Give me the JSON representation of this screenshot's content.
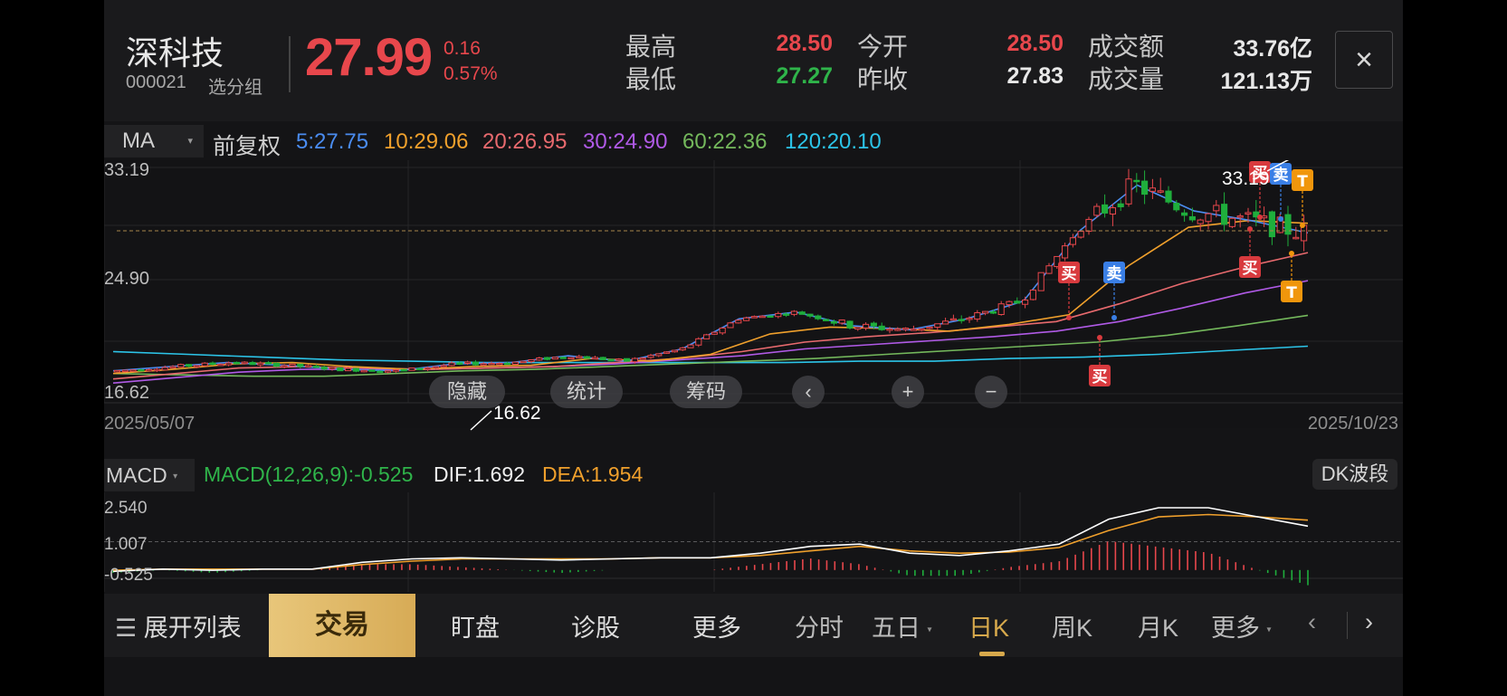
{
  "header": {
    "stock_name": "深科技",
    "stock_code": "000021",
    "group_selector": "选分组",
    "price": "27.99",
    "change": "0.16",
    "change_pct": "0.57%",
    "quotes": [
      {
        "label": "最高",
        "value": "28.50",
        "color": "red"
      },
      {
        "label": "最低",
        "value": "27.27",
        "color": "green"
      },
      {
        "label": "今开",
        "value": "28.50",
        "color": "red"
      },
      {
        "label": "昨收",
        "value": "27.83",
        "color": "white"
      },
      {
        "label": "成交额",
        "value": "33.76亿",
        "color": "white"
      },
      {
        "label": "成交量",
        "value": "121.13万",
        "color": "white"
      }
    ],
    "close_icon": "×"
  },
  "indicator_bar": {
    "selector": "MA",
    "adjust": "前复权",
    "ma_values": [
      {
        "text": "5:27.75",
        "color": "#4a8cf0"
      },
      {
        "text": "10:29.06",
        "color": "#f0a02c"
      },
      {
        "text": "20:26.95",
        "color": "#e86a6e"
      },
      {
        "text": "30:24.90",
        "color": "#b05ae6"
      },
      {
        "text": "60:22.36",
        "color": "#74b85c"
      },
      {
        "text": "120:20.10",
        "color": "#2cc4e8"
      }
    ]
  },
  "chart_data": {
    "type": "candlestick",
    "y_axis_labels": [
      "33.19",
      "24.90",
      "16.62"
    ],
    "ylim": [
      16.62,
      33.19
    ],
    "x_start": "2025/05/07",
    "x_end": "2025/10/23",
    "high_label": "33.19",
    "low_label": "16.62",
    "last_close": 27.99,
    "ma5": [
      18.3,
      18.6,
      18.9,
      18.7,
      18.4,
      18.3,
      18.8,
      18.9,
      19.4,
      19.0,
      19.9,
      22.1,
      22.6,
      21.6,
      21.3,
      22.1,
      23.4,
      28.6,
      31.9,
      30.0,
      29.3,
      28.4
    ],
    "ma10": [
      18.1,
      18.4,
      18.8,
      18.9,
      18.6,
      18.4,
      18.6,
      18.7,
      19.2,
      19.0,
      19.5,
      21.0,
      21.5,
      21.4,
      21.2,
      21.7,
      22.4,
      26.0,
      28.8,
      29.3,
      29.1
    ],
    "ma20": [
      17.7,
      18.1,
      18.5,
      18.6,
      18.5,
      18.4,
      18.5,
      18.6,
      18.9,
      19.2,
      19.7,
      20.4,
      20.8,
      21.1,
      21.5,
      21.9,
      23.2,
      24.7,
      25.9,
      26.95
    ],
    "ma30": [
      17.4,
      17.8,
      18.2,
      18.4,
      18.4,
      18.4,
      18.5,
      18.6,
      18.8,
      19.1,
      19.4,
      19.9,
      20.2,
      20.5,
      20.8,
      21.2,
      21.9,
      22.9,
      24.0,
      24.9
    ],
    "ma60": [
      18.1,
      18.0,
      17.9,
      17.9,
      18.1,
      18.3,
      18.4,
      18.6,
      18.8,
      19.0,
      19.2,
      19.5,
      19.8,
      20.1,
      20.4,
      20.9,
      21.6,
      22.36
    ],
    "ma120": [
      19.7,
      19.5,
      19.3,
      19.1,
      19.0,
      18.9,
      18.9,
      18.9,
      18.9,
      18.9,
      19.0,
      19.0,
      19.2,
      19.3,
      19.5,
      19.8,
      20.1
    ],
    "signals": [
      {
        "type": "买",
        "kind": "buy"
      },
      {
        "type": "卖",
        "kind": "sell"
      },
      {
        "type": "买",
        "kind": "buy"
      },
      {
        "type": "买",
        "kind": "buy"
      },
      {
        "type": "卖",
        "kind": "sell"
      },
      {
        "type": "买",
        "kind": "buy"
      },
      {
        "type": "T",
        "kind": "t"
      },
      {
        "type": "T",
        "kind": "t"
      }
    ]
  },
  "overlay_buttons": {
    "hide": "隐藏",
    "stats": "统计",
    "chips": "筹码",
    "left_arrow": "‹",
    "plus": "+",
    "minus": "−"
  },
  "macd": {
    "selector": "MACD",
    "params": "MACD(12,26,9):-0.525",
    "dif": "DIF:1.692",
    "dea": "DEA:1.954",
    "dk_button": "DK波段",
    "y_labels": [
      "2.540",
      "1.007",
      "-0.525"
    ],
    "dif_series": [
      -0.3,
      -0.2,
      -0.25,
      -0.2,
      -0.2,
      0.1,
      0.25,
      0.3,
      0.25,
      0.2,
      0.25,
      0.3,
      0.3,
      0.5,
      0.8,
      0.9,
      0.5,
      0.4,
      0.6,
      0.9,
      2.0,
      2.5,
      2.5,
      2.1,
      1.692
    ],
    "dea_series": [
      -0.25,
      -0.2,
      -0.2,
      -0.2,
      -0.2,
      0.0,
      0.15,
      0.25,
      0.25,
      0.25,
      0.25,
      0.3,
      0.3,
      0.4,
      0.6,
      0.8,
      0.6,
      0.5,
      0.55,
      0.75,
      1.5,
      2.1,
      2.2,
      2.1,
      1.954
    ]
  },
  "bottom_bar": {
    "expand": "展开列表",
    "trade": "交易",
    "watch": "盯盘",
    "diagnose": "诊股",
    "more": "更多",
    "periods": [
      "分时",
      "五日",
      "日K",
      "周K",
      "月K",
      "更多"
    ],
    "selected_period": "日K"
  }
}
